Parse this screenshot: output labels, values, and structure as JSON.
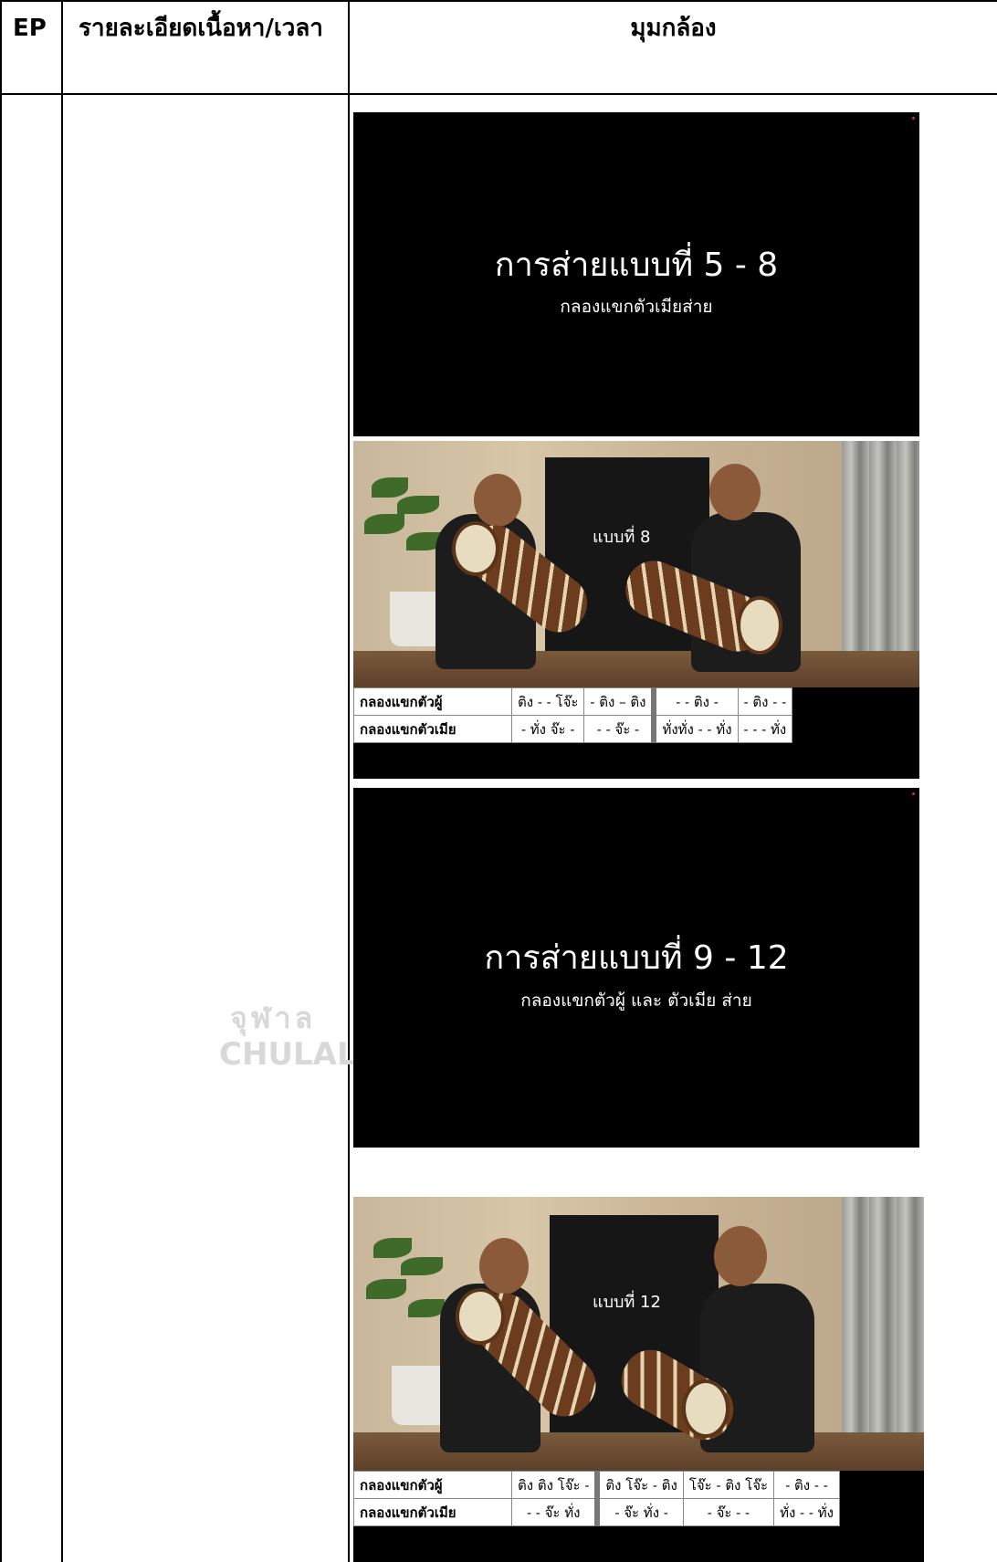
{
  "header": {
    "ep": "EP",
    "details": "รายละเอียดเนื้อหา/เวลา",
    "camera": "มุมกล้อง"
  },
  "frames": {
    "title1": {
      "title": "การส่ายแบบที่ 5 - 8",
      "subtitle": "กลองแขกตัวเมียส่าย"
    },
    "photo1": {
      "caption": "แบบที่ 8",
      "rows": [
        {
          "label": "กลองแขกตัวผู้",
          "cells": [
            "ติง - - โจ๊ะ",
            "- ติง  – ติง",
            "- - ติง -",
            "- ติง - -"
          ]
        },
        {
          "label": "กลองแขกตัวเมีย",
          "cells": [
            "- ทั่ง จ๊ะ -",
            "- - จ๊ะ -",
            "ทั่งทั่ง - - ทั่ง",
            "- - - ทั่ง"
          ]
        }
      ]
    },
    "title2": {
      "title": "การส่ายแบบที่ 9 - 12",
      "subtitle": "กลองแขกตัวผู้ และ ตัวเมีย ส่าย"
    },
    "photo2": {
      "caption": "แบบที่ 12",
      "rows": [
        {
          "label": "กลองแขกตัวผู้",
          "cells": [
            "ติง ติง โจ๊ะ -",
            "ติง โจ๊ะ - ติง",
            "โจ๊ะ - ติง โจ๊ะ",
            "- ติง - -"
          ]
        },
        {
          "label": "กลองแขกตัวเมีย",
          "cells": [
            "- - จ๊ะ ทั่ง",
            "- จ๊ะ ทั่ง -",
            "- จ๊ะ - -",
            "ทั่ง - - ทั่ง"
          ]
        }
      ]
    }
  },
  "watermark": {
    "thai": "จุฬาล",
    "latin": "CHULAL"
  },
  "colors": {
    "frame_bg": "#000000",
    "table_border": "#888888"
  }
}
